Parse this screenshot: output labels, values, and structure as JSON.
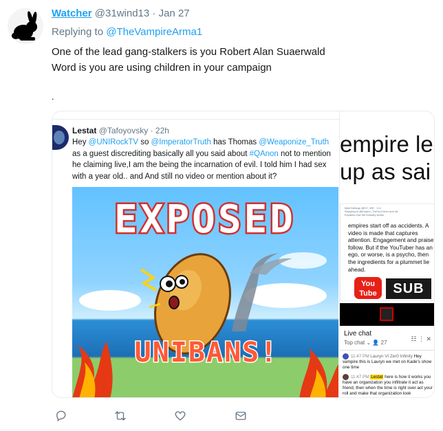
{
  "tweet": {
    "display_name": "Watcher",
    "handle": "@31wind13",
    "separator": "·",
    "date": "Jan 27",
    "reply_prefix": "Replying to",
    "reply_to": "@TheVampireArma1",
    "text_line1": "One of the lead gang-stalkers is you Robert Alan Suaerwald",
    "text_line2": "Word is you are using children in your campaign",
    "stray_mark": "."
  },
  "embedded_tweet": {
    "name": "Lestat",
    "handle": "@Tafoyovsky",
    "separator": "·",
    "time": "22h",
    "text_part1": "Hey ",
    "mention1": "@UNIRockTV",
    "text_part2": " so ",
    "mention2": "@ImperatorTruth",
    "text_part3": " has Thomas ",
    "mention3": "@Weaponize_Truth",
    "text_part4": " as a guest discrediting basically all you said about ",
    "hashtag": "#QAnon",
    "text_part5": " not to mention he claiming live,I am the being the incarnation of evil. I told him I had sex with a year old.. and And still no video or mention about it?",
    "image_title": "EXPOSED",
    "image_subtitle": "UNIBANS!"
  },
  "right_panel": {
    "big_line1": "empire les",
    "big_line2": "up as sai",
    "mini_header_line1": "Matt Deforge @DY_WE · 1 hr",
    "mini_header_line2": "Replying to @Empire_TheYouTuber and 46",
    "mini_header_line3": "Explains how the industry works",
    "mini_text": "empires start off as accidents. A video is made that captures attention. Engagement and praise follow. But if the YouTuber has an ego, or worse, is a psycho, then the ingredients for a plummet lie ahead.",
    "yt_logo_text": "You Tube",
    "sub_text": "SUB",
    "live_chat_title": "Live chat",
    "live_chat_filter": "Top chat",
    "live_chat_count": "27",
    "msg1_time": "11:47 PM",
    "msg1_name": "Lauryn VI Zer0 Infinity",
    "msg1_text": "Hey vampire this is Lauryn we met on Kade's show one time",
    "msg2_time": "11:47 PM",
    "msg2_name": "Lestat",
    "msg2_text": "here is how it works you have an organization you infiltrate it act as friend, then when the time is right over act your roll and make that organization look"
  },
  "colors": {
    "accent": "#1da1f2",
    "muted": "#657786",
    "text": "#14171a"
  },
  "icons": [
    "rabbit-avatar",
    "reply-icon",
    "retweet-icon",
    "like-icon",
    "message-icon"
  ]
}
